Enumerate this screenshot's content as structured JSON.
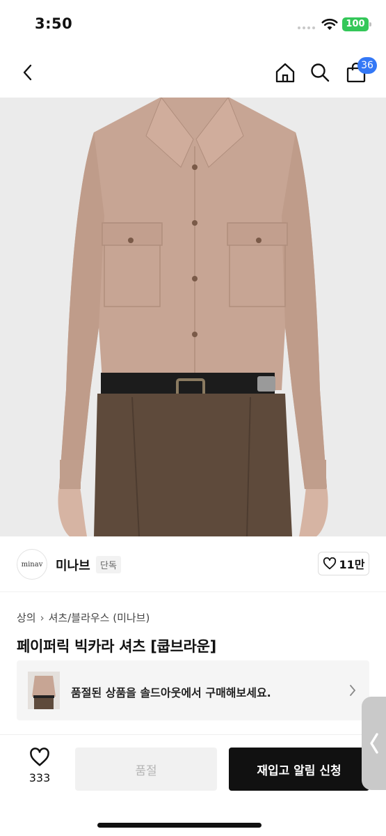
{
  "status_bar": {
    "time": "3:50",
    "battery": "100"
  },
  "nav": {
    "cart_count": "36"
  },
  "brand": {
    "logo_text": "minav",
    "name": "미나브",
    "badge": "단독",
    "like_count": "11만"
  },
  "breadcrumb": {
    "items": [
      "상의",
      "셔츠/블라우스 (미나브)"
    ]
  },
  "product": {
    "title": "페이퍼릭 빅카라 셔츠 [쿱브라운]"
  },
  "soldout_banner": {
    "text": "품절된 상품을 솔드아웃에서 구매해보세요."
  },
  "bottom": {
    "wish_count": "333",
    "soldout_label": "품절",
    "restock_label": "재입고 알림 신청"
  },
  "colors": {
    "accent_blue": "#3478f6",
    "battery_green": "#34c759",
    "shirt": "#c7a594",
    "pants": "#5e4a3b"
  }
}
